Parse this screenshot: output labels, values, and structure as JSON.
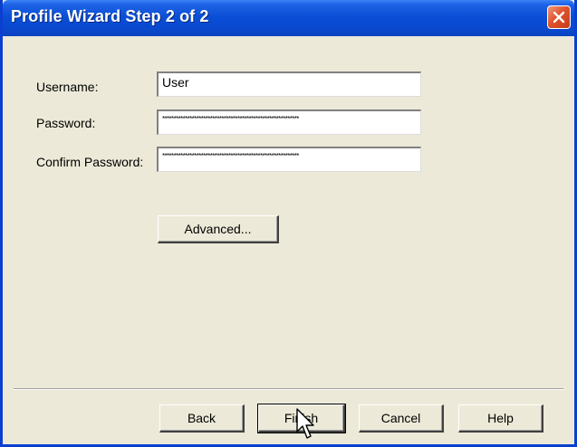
{
  "window": {
    "title": "Profile Wizard Step 2 of 2",
    "close_icon": "close-x-icon",
    "title_bar_color": "#0a4fd6",
    "close_color": "#e0522d"
  },
  "form": {
    "username_label": "Username:",
    "username_value": "User",
    "password_label": "Password:",
    "password_value": "************************************************************",
    "confirm_label": "Confirm Password:",
    "confirm_value": "************************************************************"
  },
  "buttons": {
    "advanced": "Advanced...",
    "back": "Back",
    "finish": "Finish",
    "cancel": "Cancel",
    "help": "Help"
  },
  "cursor_icon": "pointer-arrow-icon"
}
